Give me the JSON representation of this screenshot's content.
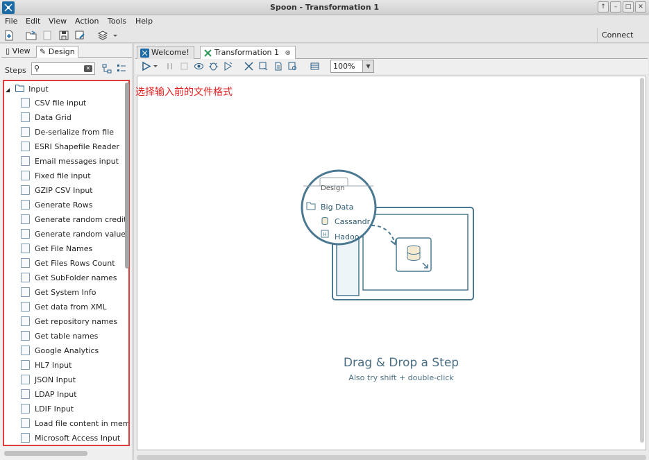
{
  "window": {
    "title": "Spoon - Transformation 1"
  },
  "menu": {
    "items": [
      "File",
      "Edit",
      "View",
      "Action",
      "Tools",
      "Help"
    ]
  },
  "toolbar": {
    "connect_label": "Connect"
  },
  "left_panel": {
    "tabs": [
      "View",
      "Design"
    ],
    "active_tab": "Design",
    "steps_label": "Steps",
    "search_placeholder": "",
    "category": "Input",
    "items": [
      "CSV file input",
      "Data Grid",
      "De-serialize from file",
      "ESRI Shapefile Reader",
      "Email messages input",
      "Fixed file input",
      "GZIP CSV Input",
      "Generate Rows",
      "Generate random credit",
      "Generate random value",
      "Get File Names",
      "Get Files Rows Count",
      "Get SubFolder names",
      "Get System Info",
      "Get data from XML",
      "Get repository names",
      "Get table names",
      "Google Analytics",
      "HL7 Input",
      "JSON Input",
      "LDAP Input",
      "LDIF Input",
      "Load file content in mem",
      "Microsoft Access Input"
    ]
  },
  "annotation": "选择输入前的文件格式",
  "editor": {
    "tabs": [
      {
        "label": "Welcome!",
        "active": false
      },
      {
        "label": "Transformation 1",
        "active": true
      }
    ],
    "zoom": "100%"
  },
  "canvas": {
    "illustration": {
      "design_tab": "Design",
      "folder": "Big Data",
      "item1": "Cassandr",
      "item2": "Hadoo"
    },
    "hint_title": "Drag & Drop a Step",
    "hint_subtitle": "Also try shift + double-click"
  },
  "colors": {
    "accent": "#1b6aa5",
    "highlight_border": "#e13b3b",
    "annotation": "#e02020",
    "hint_text": "#4a6f85"
  }
}
